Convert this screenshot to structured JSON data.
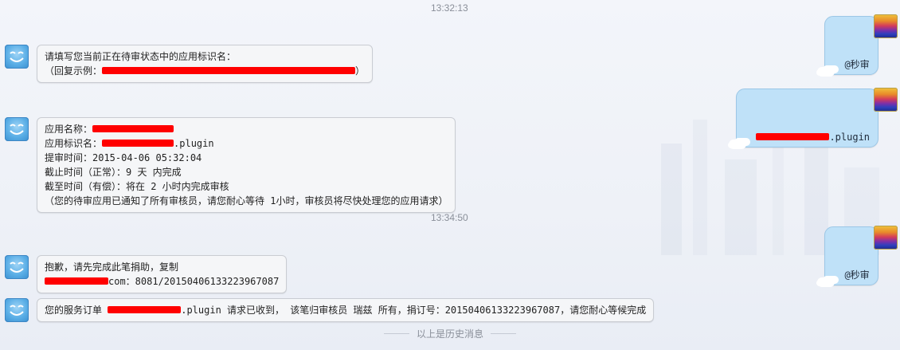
{
  "timestamps": [
    "13:32:13",
    "13:34:50"
  ],
  "messages": {
    "m1": {
      "line1": "请填写您当前正在待审状态中的应用标识名：",
      "line2_prefix": "（回复示例：",
      "line2_suffix": "）"
    },
    "m2": {
      "text": "@秒审"
    },
    "m3": {
      "suffix": ".plugin"
    },
    "m4": {
      "app_name_label": "应用名称：",
      "app_id_label": "应用标识名：",
      "app_id_suffix": ".plugin",
      "submit_time": "提审时间：2015-04-06 05:32:04",
      "deadline_normal": "截止时间（正常）：9 天 内完成",
      "deadline_paid": "截至时间（有偿）：将在 2 小时内完成审核",
      "notice": "（您的待审应用已通知了所有审核员，请您耐心等待 1小时，审核员将尽快处理您的应用请求）"
    },
    "m5": {
      "text": "@秒审"
    },
    "m6": {
      "line1": "抱歉，请先完成此笔捐助，复制",
      "line2_suffix": "com：8081/20150406133223967087"
    },
    "m7": {
      "prefix": "您的服务订单 ",
      "suffix": ".plugin 请求已收到， 该笔归审核员 瑞兹 所有，捐订号：20150406133223967087，请您耐心等候完成"
    }
  },
  "history_label": "以上是历史消息",
  "colors": {
    "redaction": "#ff0000",
    "left_bubble": "#f5f6f8",
    "right_bubble": "#bfe1f8"
  }
}
